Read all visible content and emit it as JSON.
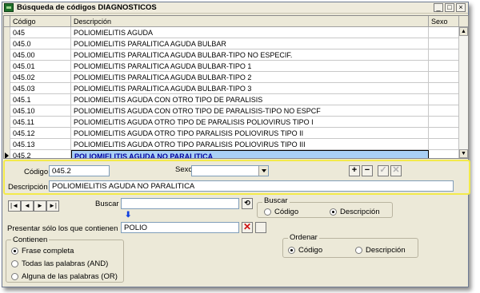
{
  "window": {
    "title": "Búsqueda de códigos DIAGNOSTICOS"
  },
  "grid": {
    "columns": [
      "Código",
      "Descripción",
      "Sexo"
    ],
    "rows": [
      {
        "code": "045",
        "desc": "POLIOMIELITIS AGUDA",
        "sex": ""
      },
      {
        "code": "045.0",
        "desc": "POLIOMIELITIS PARALITICA AGUDA BULBAR",
        "sex": ""
      },
      {
        "code": "045.00",
        "desc": "POLIOMIELITIS PARALITICA AGUDA BULBAR-TIPO NO ESPECIF.",
        "sex": ""
      },
      {
        "code": "045.01",
        "desc": "POLIOMIELITIS PARALITICA AGUDA BULBAR-TIPO 1",
        "sex": ""
      },
      {
        "code": "045.02",
        "desc": "POLIOMIELITIS PARALITICA AGUDA BULBAR-TIPO 2",
        "sex": ""
      },
      {
        "code": "045.03",
        "desc": "POLIOMIELITIS PARALITICA AGUDA BULBAR-TIPO 3",
        "sex": ""
      },
      {
        "code": "045.1",
        "desc": "POLIOMIELITIS AGUDA CON OTRO TIPO DE PARALISIS",
        "sex": ""
      },
      {
        "code": "045.10",
        "desc": "POLIOMIELITIS AGUDA CON OTRO TIPO DE PARALISIS-TIPO NO ESPCF",
        "sex": ""
      },
      {
        "code": "045.11",
        "desc": "POLIOMIELITIS AGUDA OTRO TIPO DE PARALISIS POLIOVIRUS TIPO I",
        "sex": ""
      },
      {
        "code": "045.12",
        "desc": "POLIOMIELITIS AGUDA OTRO TIPO PARALISIS POLIOVIRUS TIPO II",
        "sex": ""
      },
      {
        "code": "045.13",
        "desc": "POLIOMIELITIS AGUDA OTRO TIPO PARALISIS POLIOVIRUS TIPO III",
        "sex": ""
      },
      {
        "code": "045.2",
        "desc": "POLIOMIELITIS AGUDA NO PARALITICA",
        "sex": ""
      }
    ],
    "selected_index": 11
  },
  "edit": {
    "codigo_label": "Código",
    "codigo_value": "045.2",
    "sexo_label": "Sexo",
    "sexo_value": "",
    "descripcion_label": "Descripción",
    "descripcion_value": "POLIOMIELITIS AGUDA NO PARALITICA",
    "add_label": "+",
    "remove_label": "−",
    "accept_label": "✓",
    "cancel_label": "✕"
  },
  "nav": {
    "first": "|◄",
    "prev": "◄",
    "next": "►",
    "last": "►|"
  },
  "search": {
    "buscar_label": "Buscar",
    "buscar_value": "",
    "presentar_label": "Presentar sólo los que contienen",
    "presentar_value": "POLIO",
    "buscar_group_title": "Buscar",
    "buscar_opt_codigo": "Código",
    "buscar_opt_descripcion": "Descripción"
  },
  "contienen": {
    "title": "Contienen",
    "opt1": "Frase completa",
    "opt2": "Todas las palabras (AND)",
    "opt3": "Alguna de las palabras (OR)"
  },
  "ordenar": {
    "title": "Ordenar",
    "opt_codigo": "Código",
    "opt_descripcion": "Descripción"
  }
}
